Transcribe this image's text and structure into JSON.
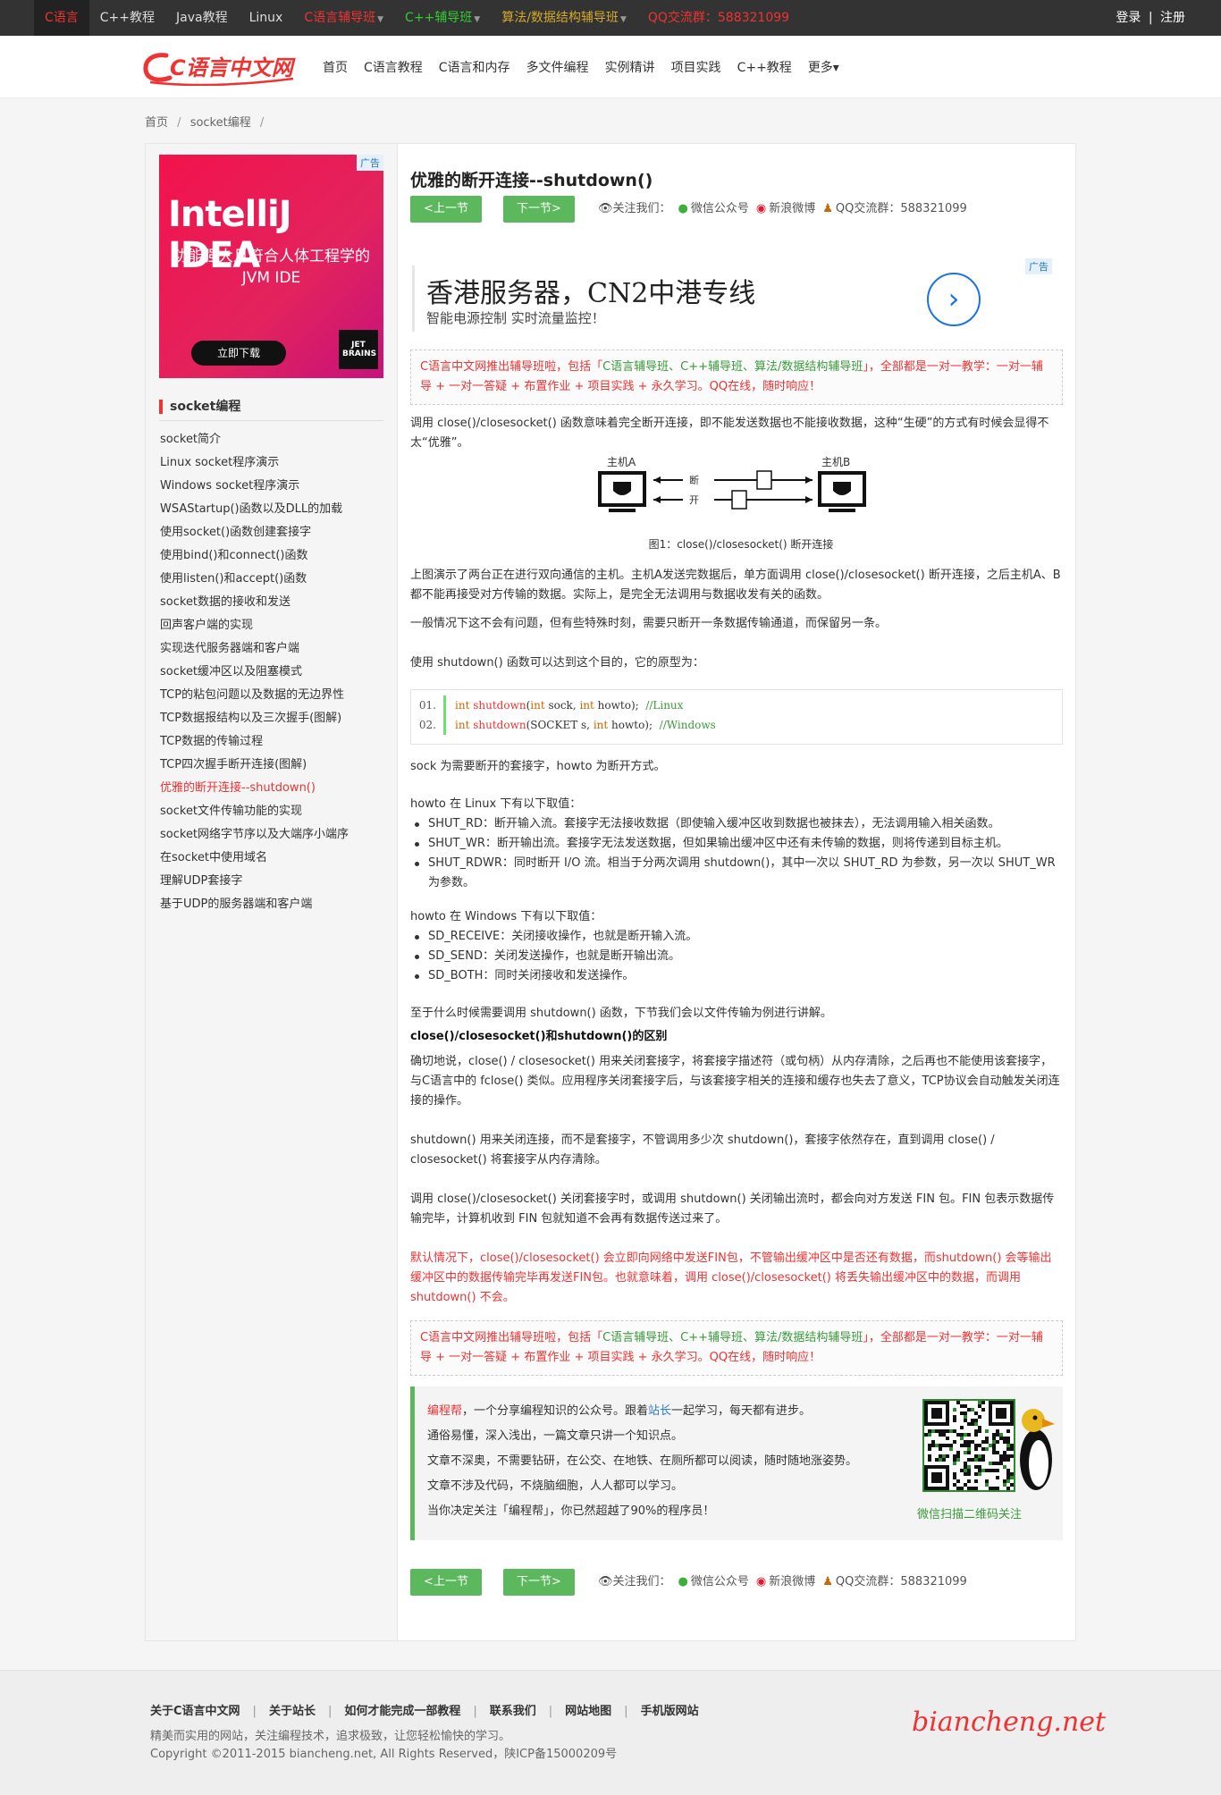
{
  "topbar": {
    "items": [
      {
        "label": "C语言",
        "color": "active"
      },
      {
        "label": "C++教程",
        "color": "plain"
      },
      {
        "label": "Java教程",
        "color": "plain"
      },
      {
        "label": "Linux",
        "color": "plain"
      },
      {
        "label": "C语言辅导班",
        "color": "red",
        "dropdown": true
      },
      {
        "label": "C++辅导班",
        "color": "green",
        "dropdown": true
      },
      {
        "label": "算法/数据结构辅导班",
        "color": "yellow",
        "dropdown": true
      },
      {
        "label": "QQ交流群：588321099",
        "color": "red"
      }
    ],
    "login": "登录",
    "divider": "|",
    "register": "注册"
  },
  "header": {
    "logo_text": "C语言中文网",
    "nav": [
      "首页",
      "C语言教程",
      "C语言和内存",
      "多文件编程",
      "实例精讲",
      "项目实践",
      "C++教程",
      "更多▾"
    ]
  },
  "breadcrumb": {
    "home": "首页",
    "section": "socket编程",
    "sep": "/"
  },
  "sidebar": {
    "ad": {
      "tag": "广告",
      "headline": "IntelliJ IDEA",
      "line1": "功能强大且符合人体工程学的",
      "line2": "JVM IDE",
      "button": "立即下载",
      "brand1": "JET",
      "brand2": "BRAINS"
    },
    "title": "socket编程",
    "items": [
      "socket简介",
      "Linux socket程序演示",
      "Windows socket程序演示",
      "WSAStartup()函数以及DLL的加载",
      "使用socket()函数创建套接字",
      "使用bind()和connect()函数",
      "使用listen()和accept()函数",
      "socket数据的接收和发送",
      "回声客户端的实现",
      "实现迭代服务器端和客户端",
      "socket缓冲区以及阻塞模式",
      "TCP的粘包问题以及数据的无边界性",
      "TCP数据报结构以及三次握手(图解)",
      "TCP数据的传输过程",
      "TCP四次握手断开连接(图解)",
      "优雅的断开连接--shutdown()",
      "socket文件传输功能的实现",
      "socket网络字节序以及大端序小端序",
      "在socket中使用域名",
      "理解UDP套接字",
      "基于UDP的服务器端和客户端"
    ],
    "current_index": 15
  },
  "article": {
    "title": "优雅的断开连接--shutdown()",
    "prev": "<上一节",
    "next": "下一节>",
    "follow_label": "关注我们：",
    "wechat": "微信公众号",
    "weibo": "新浪微博",
    "qq_group": "QQ交流群：588321099",
    "ad_top": {
      "tag": "广告",
      "headline": "香港服务器，CN2中港专线",
      "sub": "智能电源控制 实时流量监控！"
    },
    "notice": {
      "part1": "C语言中文网推出辅导班啦，包括「",
      "highlight": "C语言辅导班、C++辅导班、算法/数据结构辅导班",
      "part2": "」，全部都是一对一教学：一对一辅导 + 一对一答疑 + 布置作业 + 项目实践 + 永久学习。QQ在线，随时响应！"
    },
    "p1": "调用 close()/closesocket() 函数意味着完全断开连接，即不能发送数据也不能接收数据，这种“生硬”的方式有时候会显得不太“优雅”。",
    "figure": {
      "hostA": "主机A",
      "hostB": "主机B",
      "c1": "断",
      "c2": "开",
      "caption": "图1：close()/closesocket() 断开连接"
    },
    "p2": "上图演示了两台正在进行双向通信的主机。主机A发送完数据后，单方面调用 close()/closesocket() 断开连接，之后主机A、B都不能再接受对方传输的数据。实际上，是完全无法调用与数据收发有关的函数。",
    "p3": "一般情况下这不会有问题，但有些特殊时刻，需要只断开一条数据传输通道，而保留另一条。",
    "p4": "使用 shutdown() 函数可以达到这个目的，它的原型为：",
    "code": [
      {
        "no": "01.",
        "kw": "int",
        "fn": "shutdown",
        "args1": "(",
        "kw2": "int",
        "args2": " sock, ",
        "kw3": "int",
        "args3": " howto);  ",
        "cm": "//Linux"
      },
      {
        "no": "02.",
        "kw": "int",
        "fn": "shutdown",
        "args1": "(SOCKET s, ",
        "kw2": "",
        "args2": "",
        "kw3": "int",
        "args3": " howto);  ",
        "cm": "//Windows"
      }
    ],
    "p5": "sock 为需要断开的套接字，howto 为断开方式。",
    "p6": "howto 在 Linux 下有以下取值：",
    "linux_list": [
      "SHUT_RD：断开输入流。套接字无法接收数据（即使输入缓冲区收到数据也被抹去），无法调用输入相关函数。",
      "SHUT_WR：断开输出流。套接字无法发送数据，但如果输出缓冲区中还有未传输的数据，则将传递到目标主机。",
      "SHUT_RDWR：同时断开 I/O 流。相当于分两次调用 shutdown()，其中一次以 SHUT_RD 为参数，另一次以 SHUT_WR 为参数。"
    ],
    "p7": "howto 在 Windows 下有以下取值：",
    "win_list": [
      "SD_RECEIVE：关闭接收操作，也就是断开输入流。",
      "SD_SEND：关闭发送操作，也就是断开输出流。",
      "SD_BOTH：同时关闭接收和发送操作。"
    ],
    "p8": "至于什么时候需要调用 shutdown() 函数，下节我们会以文件传输为例进行讲解。",
    "h2": "close()/closesocket()和shutdown()的区别",
    "p9": "确切地说，close() / closesocket() 用来关闭套接字，将套接字描述符（或句柄）从内存清除，之后再也不能使用该套接字，与C语言中的 fclose() 类似。应用程序关闭套接字后，与该套接字相关的连接和缓存也失去了意义，TCP协议会自动触发关闭连接的操作。",
    "p10": "shutdown() 用来关闭连接，而不是套接字，不管调用多少次 shutdown()，套接字依然存在，直到调用 close() / closesocket() 将套接字从内存清除。",
    "p11": "调用 close()/closesocket() 关闭套接字时，或调用 shutdown() 关闭输出流时，都会向对方发送 FIN 包。FIN 包表示数据传输完毕，计算机收到 FIN 包就知道不会再有数据传送过来了。",
    "p12": "默认情况下，close()/closesocket() 会立即向网络中发送FIN包，不管输出缓冲区中是否还有数据，而shutdown() 会等输出缓冲区中的数据传输完毕再发送FIN包。也就意味着，调用 close()/closesocket() 将丢失输出缓冲区中的数据，而调用 shutdown() 不会。",
    "wx": {
      "brand": "编程帮",
      "l1a": "，一个分享编程知识的公众号。跟着",
      "l1b": "站长",
      "l1c": "一起学习，每天都有进步。",
      "l2": "通俗易懂，深入浅出，一篇文章只讲一个知识点。",
      "l3": "文章不深奥，不需要钻研，在公交、在地铁、在厕所都可以阅读，随时随地涨姿势。",
      "l4": "文章不涉及代码，不烧脑细胞，人人都可以学习。",
      "l5": "当你决定关注「编程帮」，你已然超越了90%的程序员！",
      "caption": "微信扫描二维码关注"
    }
  },
  "footer": {
    "links": [
      "关于C语言中文网",
      "关于站长",
      "如何才能完成一部教程",
      "联系我们",
      "网站地图",
      "手机版网站"
    ],
    "slogan": "精美而实用的网站，关注编程技术，追求极致，让您轻松愉快的学习。",
    "copyright": "Copyright ©2011-2015 biancheng.net, All Rights Reserved，陕ICP备15000209号",
    "brand": "biancheng.net"
  },
  "colors": {
    "accent": "#e33333",
    "button": "#5cb85c",
    "dark_bar": "#333333"
  }
}
